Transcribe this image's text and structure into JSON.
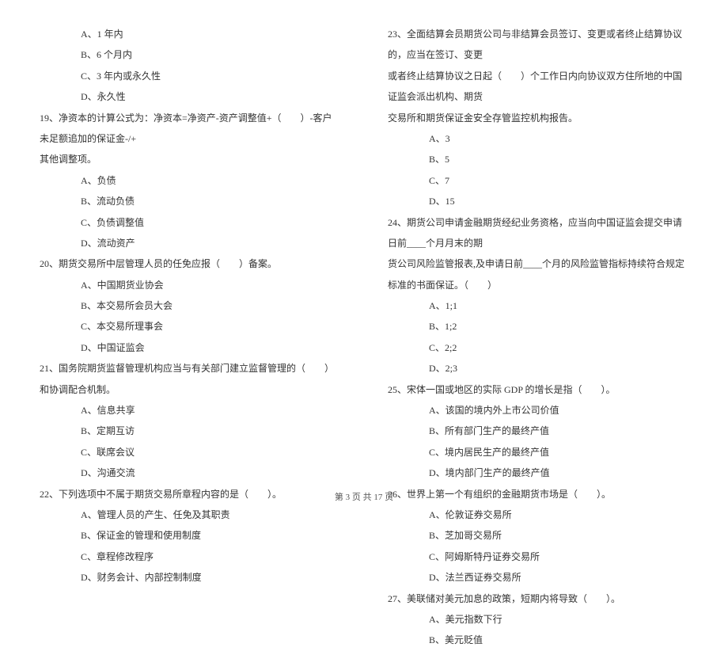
{
  "left": {
    "opt_18a": "A、1 年内",
    "opt_18b": "B、6 个月内",
    "opt_18c": "C、3 年内或永久性",
    "opt_18d": "D、永久性",
    "q19": "19、净资本的计算公式为：净资本=净资产-资产调整值+（　　）-客户未足额追加的保证金-/+",
    "q19_cont": "其他调整项。",
    "opt_19a": "A、负债",
    "opt_19b": "B、流动负债",
    "opt_19c": "C、负债调整值",
    "opt_19d": "D、流动资产",
    "q20": "20、期货交易所中层管理人员的任免应报（　　）备案。",
    "opt_20a": "A、中国期货业协会",
    "opt_20b": "B、本交易所会员大会",
    "opt_20c": "C、本交易所理事会",
    "opt_20d": "D、中国证监会",
    "q21": "21、国务院期货监督管理机构应当与有关部门建立监督管理的（　　）和协调配合机制。",
    "opt_21a": "A、信息共享",
    "opt_21b": "B、定期互访",
    "opt_21c": "C、联席会议",
    "opt_21d": "D、沟通交流",
    "q22": "22、下列选项中不属于期货交易所章程内容的是（　　）。",
    "opt_22a": "A、管理人员的产生、任免及其职责",
    "opt_22b": "B、保证金的管理和使用制度",
    "opt_22c": "C、章程修改程序",
    "opt_22d": "D、财务会计、内部控制制度"
  },
  "right": {
    "q23": "23、全面结算会员期货公司与非结算会员签订、变更或者终止结算协议的，应当在签订、变更",
    "q23_cont1": "或者终止结算协议之日起（　　）个工作日内向协议双方住所地的中国证监会派出机构、期货",
    "q23_cont2": "交易所和期货保证金安全存管监控机构报告。",
    "opt_23a": "A、3",
    "opt_23b": "B、5",
    "opt_23c": "C、7",
    "opt_23d": "D、15",
    "q24": "24、期货公司申请金融期货经纪业务资格，应当向中国证监会提交申请日前____个月月末的期",
    "q24_cont": "货公司风险监管报表,及申请日前____个月的风险监管指标持续符合规定标准的书面保证。（　　）",
    "opt_24a": "A、1;1",
    "opt_24b": "B、1;2",
    "opt_24c": "C、2;2",
    "opt_24d": "D、2;3",
    "q25": "25、宋体一国或地区的实际 GDP 的增长是指（　　）。",
    "opt_25a": "A、该国的境内外上市公司价值",
    "opt_25b": "B、所有部门生产的最终产值",
    "opt_25c": "C、境内居民生产的最终产值",
    "opt_25d": "D、境内部门生产的最终产值",
    "q26": "26、世界上第一个有组织的金融期货市场是（　　）。",
    "opt_26a": "A、伦敦证券交易所",
    "opt_26b": "B、芝加哥交易所",
    "opt_26c": "C、阿姆斯特丹证券交易所",
    "opt_26d": "D、法兰西证券交易所",
    "q27": "27、美联储对美元加息的政策，短期内将导致（　　）。",
    "opt_27a": "A、美元指数下行",
    "opt_27b": "B、美元贬值"
  },
  "footer": "第 3 页 共 17 页"
}
